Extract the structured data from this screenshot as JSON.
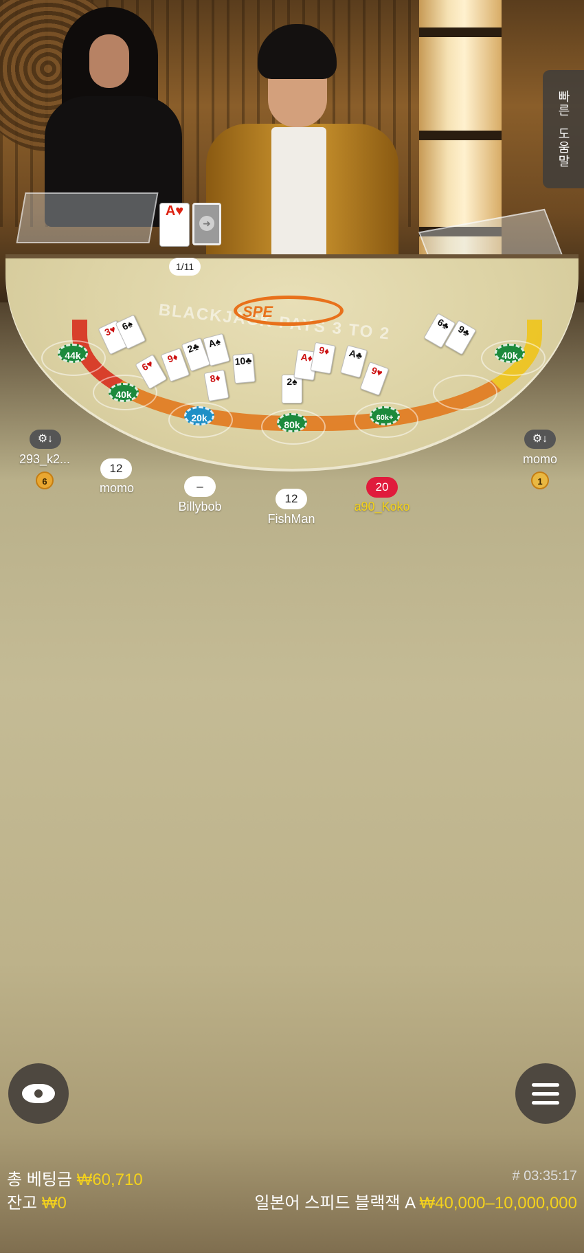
{
  "help_tab": {
    "line1": "빠른",
    "line2": "도움말"
  },
  "dealer_cards": {
    "up_card": "A♥",
    "shoe_count": "1/11"
  },
  "table": {
    "logo": "SPE",
    "text": "BLACKJACK PAYS 3 TO 2"
  },
  "chips": [
    "44k",
    "40k",
    "20k",
    "80k",
    "60k+",
    "40k"
  ],
  "players": [
    {
      "name": "293_k2...",
      "medal": "6"
    },
    {
      "name": "momo",
      "score": "12"
    },
    {
      "name": "Billybob",
      "score": "–"
    },
    {
      "name": "FishMan",
      "score": "12"
    },
    {
      "name": "a90_Koko",
      "score": "20"
    },
    {
      "name": "momo",
      "medal": "1"
    }
  ],
  "footer": {
    "total_bet_label": "총 베팅금",
    "total_bet_value": "₩60,710",
    "balance_label": "잔고",
    "balance_value": "₩0",
    "round_id": "# 03:35:17",
    "table_name": "일본어 스피드 블랙잭 A",
    "limits": "₩40,000–10,000,000"
  }
}
